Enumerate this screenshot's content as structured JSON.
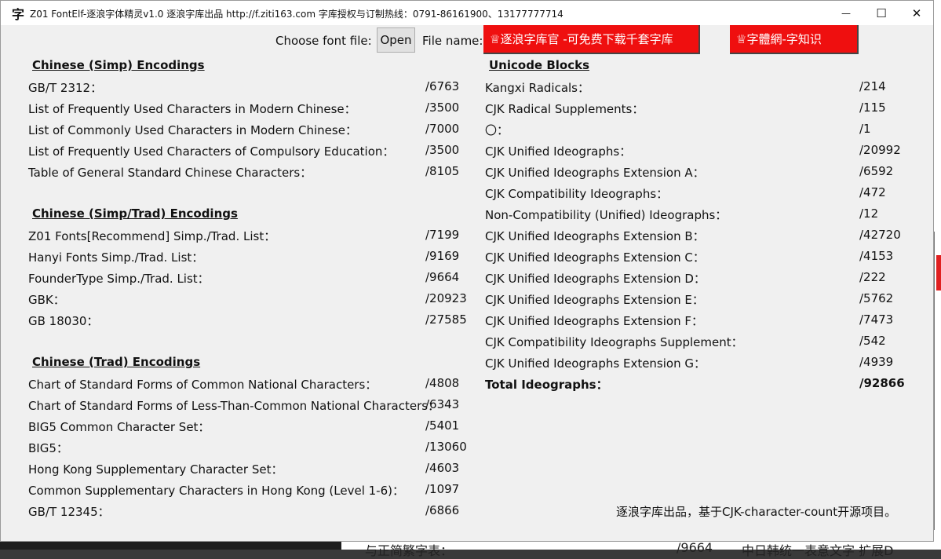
{
  "window": {
    "app_icon_glyph": "字",
    "title": "Z01 FontElf-逐浪字体精灵v1.0 逐浪字库出品 http://f.ziti163.com 字库授权与订制热线：0791-86161900、13177777714",
    "minimize_glyph": "—",
    "maximize_glyph": "☐",
    "close_glyph": "✕"
  },
  "toolbar": {
    "choose_font_label": "Choose font file:",
    "open_button": "Open",
    "file_name_label": "File name:",
    "banner_left": "♕逐浪字库官 -可免费下载千套字库",
    "banner_right": "♕字體網-字知识"
  },
  "simp": {
    "title": "Chinese (Simp) Encodings",
    "rows": [
      {
        "label": "GB/T 2312：",
        "value": "/6763"
      },
      {
        "label": "List of Frequently Used Characters in Modern Chinese：",
        "value": "/3500"
      },
      {
        "label": "List of Commonly Used Characters in Modern Chinese：",
        "value": "/7000"
      },
      {
        "label": "List of Frequently Used Characters of Compulsory Education：",
        "value": "/3500"
      },
      {
        "label": "Table of General Standard Chinese Characters：",
        "value": "/8105"
      }
    ]
  },
  "simptrad": {
    "title": "Chinese (Simp/Trad) Encodings",
    "rows": [
      {
        "label": "Z01 Fonts[Recommend] Simp./Trad. List：",
        "value": "/7199"
      },
      {
        "label": "Hanyi Fonts Simp./Trad. List：",
        "value": "/9169"
      },
      {
        "label": "FounderType Simp./Trad. List：",
        "value": "/9664"
      },
      {
        "label": "GBK：",
        "value": "/20923"
      },
      {
        "label": "GB 18030：",
        "value": "/27585"
      }
    ]
  },
  "trad": {
    "title": "Chinese (Trad) Encodings",
    "rows": [
      {
        "label": "Chart of Standard Forms of Common National Characters：",
        "value": "/4808"
      },
      {
        "label": "Chart of Standard Forms of Less-Than-Common National Characters：",
        "value": "/6343"
      },
      {
        "label": "BIG5 Common Character Set：",
        "value": "/5401"
      },
      {
        "label": "BIG5：",
        "value": "/13060"
      },
      {
        "label": "Hong Kong Supplementary Character Set：",
        "value": "/4603"
      },
      {
        "label": "Common Supplementary Characters in Hong Kong (Level 1-6)：",
        "value": "/1097"
      },
      {
        "label": "GB/T 12345：",
        "value": "/6866"
      }
    ]
  },
  "unicode": {
    "title": "Unicode Blocks",
    "rows": [
      {
        "label": "Kangxi Radicals：",
        "value": "/214"
      },
      {
        "label": "CJK Radical Supplements：",
        "value": "/115"
      },
      {
        "label": "〇：",
        "value": "/1"
      },
      {
        "label": "CJK Unified Ideographs：",
        "value": "/20992"
      },
      {
        "label": "CJK Unified Ideographs Extension A：",
        "value": "/6592"
      },
      {
        "label": "CJK Compatibility Ideographs：",
        "value": "/472"
      },
      {
        "label": " Non-Compatibility (Unified) Ideographs：",
        "value": "/12"
      },
      {
        "label": "CJK Unified Ideographs Extension B：",
        "value": "/42720"
      },
      {
        "label": "CJK Unified Ideographs Extension C：",
        "value": "/4153"
      },
      {
        "label": "CJK Unified Ideographs Extension D：",
        "value": "/222"
      },
      {
        "label": "CJK Unified Ideographs Extension E：",
        "value": "/5762"
      },
      {
        "label": "CJK Unified Ideographs Extension F：",
        "value": "/7473"
      },
      {
        "label": "CJK Compatibility Ideographs Supplement：",
        "value": "/542"
      },
      {
        "label": "CJK Unified Ideographs Extension G：",
        "value": "/4939"
      }
    ],
    "total_label": "Total Ideographs：",
    "total_value": "/92866"
  },
  "footer": "逐浪字库出品，基于CJK-character-count开源项目。",
  "background": {
    "bottom_text_left": "与正简繁字表：",
    "bottom_text_mid": "/9664",
    "bottom_text_right": "中日韩统一表意文字 扩展D"
  }
}
